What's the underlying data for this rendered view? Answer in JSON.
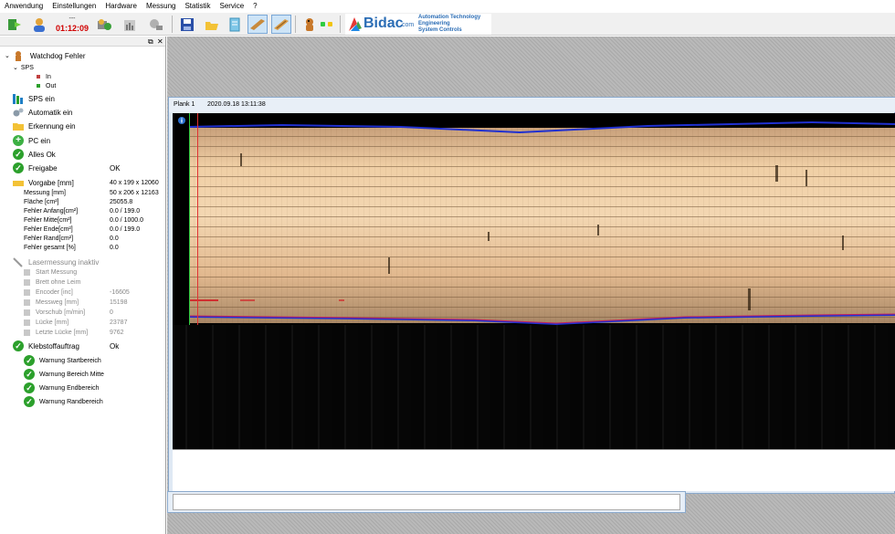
{
  "menu": [
    "Anwendung",
    "Einstellungen",
    "Hardware",
    "Messung",
    "Statistik",
    "Service",
    "?"
  ],
  "toolbar": {
    "time_dash": "---",
    "time_value": "01:12:09",
    "buttons": [
      "exit-icon",
      "user-icon",
      "camera-settings-icon",
      "stats-icon",
      "tools-icon",
      "save-icon",
      "open-folder-icon",
      "document-icon",
      "plank-icon",
      "plank-edit-icon",
      "dog-icon"
    ],
    "dot_colors": [
      "#2ecc40",
      "#f1c40f"
    ]
  },
  "logo": {
    "word": "Bidac",
    "suffix": ".com",
    "lines": [
      "Automation Technology",
      "Engineering",
      "System Controls"
    ]
  },
  "panel": {
    "header_buttons": [
      "⧉",
      "✕"
    ],
    "tree": {
      "root": "Watchdog Fehler",
      "sps": "SPS",
      "in": "In",
      "out": "Out"
    },
    "status": [
      "SPS ein",
      "Automatik ein",
      "Erkennung ein",
      "PC ein",
      "Alles Ok"
    ],
    "freigabe": {
      "label": "Freigabe",
      "value": "OK"
    },
    "vorgabe": {
      "label": "Vorgabe [mm]",
      "value": "40 x 199 x 12060"
    },
    "measurements": [
      {
        "label": "Messung [mm]",
        "value": "50 x 206 x 12163"
      },
      {
        "label": "Fläche [cm²]",
        "value": "25055.8"
      },
      {
        "label": "Fehler Anfang[cm²]",
        "value": "0.0 / 199.0"
      },
      {
        "label": "Fehler Mitte[cm²]",
        "value": "0.0 / 1000.0"
      },
      {
        "label": "Fehler Ende[cm²]",
        "value": "0.0 / 199.0"
      },
      {
        "label": "Fehler Rand[cm²]",
        "value": "0.0"
      },
      {
        "label": "Fehler gesamt [%]",
        "value": "0.0"
      }
    ],
    "laser": {
      "label": "Lasermessung inaktiv",
      "items": [
        {
          "label": "Start Messung",
          "value": ""
        },
        {
          "label": "Brett ohne Leim",
          "value": ""
        },
        {
          "label": "Encoder [inc]",
          "value": "-16605"
        },
        {
          "label": "Messweg [mm]",
          "value": "15198"
        },
        {
          "label": "Vorschub [m/min]",
          "value": "0"
        },
        {
          "label": "Lücke [mm]",
          "value": "23787"
        },
        {
          "label": "Letzte Lücke [mm]",
          "value": "9762"
        }
      ]
    },
    "kleb": {
      "label": "Klebstoffauftrag",
      "value": "Ok",
      "warnings": [
        "Warnung Startbereich",
        "Warnung Bereich Mitte",
        "Warnung Endbereich",
        "Warnung Randbereich"
      ]
    }
  },
  "plank": {
    "name": "Plank 1",
    "date": "2020.09.18 13:11:38"
  }
}
